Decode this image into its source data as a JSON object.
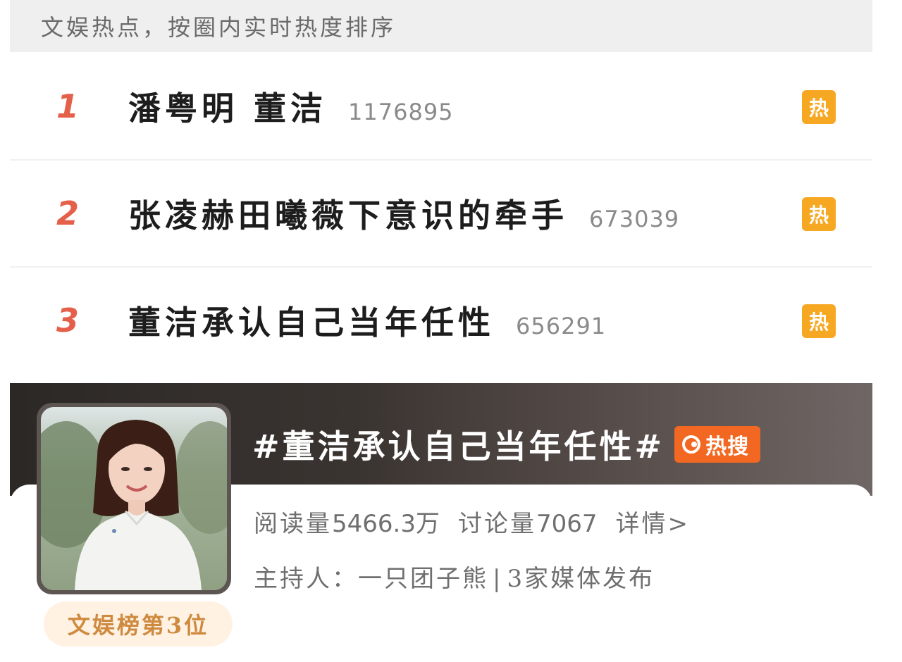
{
  "header": {
    "text": "文娱热点，按圈内实时热度排序"
  },
  "rank_list": [
    {
      "rank": "1",
      "title": "潘粤明 董洁",
      "count": "1176895",
      "badge": "热"
    },
    {
      "rank": "2",
      "title": "张凌赫田曦薇下意识的牵手",
      "count": "673039",
      "badge": "热"
    },
    {
      "rank": "3",
      "title": "董洁承认自己当年任性",
      "count": "656291",
      "badge": "热"
    }
  ],
  "topic": {
    "title": "#董洁承认自己当年任性#",
    "hot_badge_label": "热搜",
    "read_label": "阅读量",
    "read_value": "5466.3万",
    "discuss_label": "讨论量",
    "discuss_value": "7067",
    "detail_link": "详情>",
    "host_label": "主持人：",
    "host_name": "一只团子熊",
    "separator": "|",
    "media_text": "3家媒体发布",
    "rank_tag": "文娱榜第3位"
  },
  "colors": {
    "rank_red": "#e5604a",
    "hot_badge": "#f7a823",
    "hot_search_badge": "#f26822",
    "rank_tag_text": "#ce8a3f"
  },
  "icons": {
    "hot_search_icon": "hot-search-icon",
    "avatar": "person-photo"
  }
}
